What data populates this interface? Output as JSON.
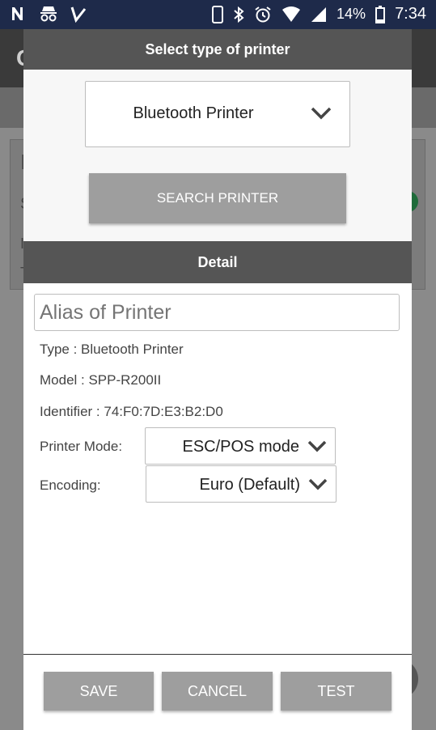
{
  "status_bar": {
    "battery_percent": "14%",
    "time": "7:34"
  },
  "background_app": {
    "title_initial": "C",
    "card_letters": [
      "I",
      "S",
      "I",
      "T"
    ]
  },
  "dialog": {
    "header": "Select type of printer",
    "printer_type_selected": "Bluetooth Printer",
    "search_button": "SEARCH PRINTER",
    "detail_header": "Detail",
    "alias_placeholder": "Alias of Printer",
    "type_line": "Type : Bluetooth Printer",
    "model_line": "Model : SPP-R200II",
    "identifier_line": "Identifier : 74:F0:7D:E3:B2:D0",
    "printer_mode_label": "Printer Mode:",
    "printer_mode_value": "ESC/POS mode",
    "encoding_label": "Encoding:",
    "encoding_value": "Euro (Default)",
    "buttons": {
      "save": "SAVE",
      "cancel": "CANCEL",
      "test": "TEST"
    }
  },
  "colors": {
    "status_bar": "#1e2a4a",
    "dialog_header": "#555555",
    "button_gray": "#9e9e9e"
  }
}
